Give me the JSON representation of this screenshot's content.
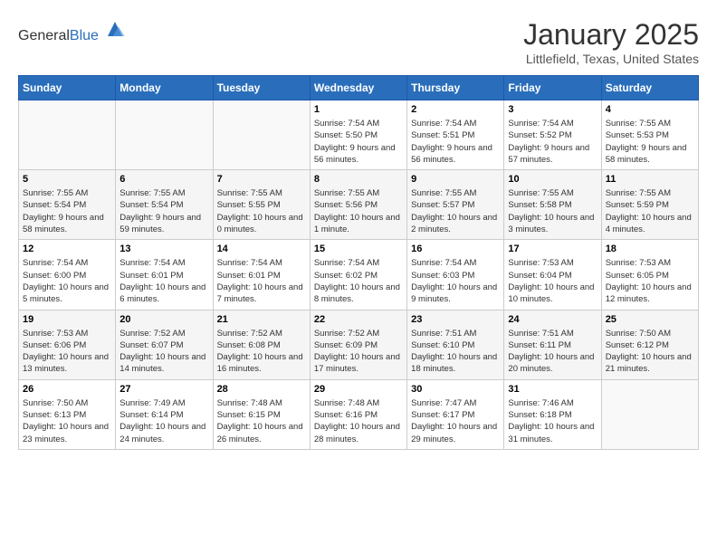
{
  "header": {
    "logo_general": "General",
    "logo_blue": "Blue",
    "month_title": "January 2025",
    "location": "Littlefield, Texas, United States"
  },
  "days_of_week": [
    "Sunday",
    "Monday",
    "Tuesday",
    "Wednesday",
    "Thursday",
    "Friday",
    "Saturday"
  ],
  "weeks": [
    [
      {
        "day": "",
        "sunrise": "",
        "sunset": "",
        "daylight": ""
      },
      {
        "day": "",
        "sunrise": "",
        "sunset": "",
        "daylight": ""
      },
      {
        "day": "",
        "sunrise": "",
        "sunset": "",
        "daylight": ""
      },
      {
        "day": "1",
        "sunrise": "Sunrise: 7:54 AM",
        "sunset": "Sunset: 5:50 PM",
        "daylight": "Daylight: 9 hours and 56 minutes."
      },
      {
        "day": "2",
        "sunrise": "Sunrise: 7:54 AM",
        "sunset": "Sunset: 5:51 PM",
        "daylight": "Daylight: 9 hours and 56 minutes."
      },
      {
        "day": "3",
        "sunrise": "Sunrise: 7:54 AM",
        "sunset": "Sunset: 5:52 PM",
        "daylight": "Daylight: 9 hours and 57 minutes."
      },
      {
        "day": "4",
        "sunrise": "Sunrise: 7:55 AM",
        "sunset": "Sunset: 5:53 PM",
        "daylight": "Daylight: 9 hours and 58 minutes."
      }
    ],
    [
      {
        "day": "5",
        "sunrise": "Sunrise: 7:55 AM",
        "sunset": "Sunset: 5:54 PM",
        "daylight": "Daylight: 9 hours and 58 minutes."
      },
      {
        "day": "6",
        "sunrise": "Sunrise: 7:55 AM",
        "sunset": "Sunset: 5:54 PM",
        "daylight": "Daylight: 9 hours and 59 minutes."
      },
      {
        "day": "7",
        "sunrise": "Sunrise: 7:55 AM",
        "sunset": "Sunset: 5:55 PM",
        "daylight": "Daylight: 10 hours and 0 minutes."
      },
      {
        "day": "8",
        "sunrise": "Sunrise: 7:55 AM",
        "sunset": "Sunset: 5:56 PM",
        "daylight": "Daylight: 10 hours and 1 minute."
      },
      {
        "day": "9",
        "sunrise": "Sunrise: 7:55 AM",
        "sunset": "Sunset: 5:57 PM",
        "daylight": "Daylight: 10 hours and 2 minutes."
      },
      {
        "day": "10",
        "sunrise": "Sunrise: 7:55 AM",
        "sunset": "Sunset: 5:58 PM",
        "daylight": "Daylight: 10 hours and 3 minutes."
      },
      {
        "day": "11",
        "sunrise": "Sunrise: 7:55 AM",
        "sunset": "Sunset: 5:59 PM",
        "daylight": "Daylight: 10 hours and 4 minutes."
      }
    ],
    [
      {
        "day": "12",
        "sunrise": "Sunrise: 7:54 AM",
        "sunset": "Sunset: 6:00 PM",
        "daylight": "Daylight: 10 hours and 5 minutes."
      },
      {
        "day": "13",
        "sunrise": "Sunrise: 7:54 AM",
        "sunset": "Sunset: 6:01 PM",
        "daylight": "Daylight: 10 hours and 6 minutes."
      },
      {
        "day": "14",
        "sunrise": "Sunrise: 7:54 AM",
        "sunset": "Sunset: 6:01 PM",
        "daylight": "Daylight: 10 hours and 7 minutes."
      },
      {
        "day": "15",
        "sunrise": "Sunrise: 7:54 AM",
        "sunset": "Sunset: 6:02 PM",
        "daylight": "Daylight: 10 hours and 8 minutes."
      },
      {
        "day": "16",
        "sunrise": "Sunrise: 7:54 AM",
        "sunset": "Sunset: 6:03 PM",
        "daylight": "Daylight: 10 hours and 9 minutes."
      },
      {
        "day": "17",
        "sunrise": "Sunrise: 7:53 AM",
        "sunset": "Sunset: 6:04 PM",
        "daylight": "Daylight: 10 hours and 10 minutes."
      },
      {
        "day": "18",
        "sunrise": "Sunrise: 7:53 AM",
        "sunset": "Sunset: 6:05 PM",
        "daylight": "Daylight: 10 hours and 12 minutes."
      }
    ],
    [
      {
        "day": "19",
        "sunrise": "Sunrise: 7:53 AM",
        "sunset": "Sunset: 6:06 PM",
        "daylight": "Daylight: 10 hours and 13 minutes."
      },
      {
        "day": "20",
        "sunrise": "Sunrise: 7:52 AM",
        "sunset": "Sunset: 6:07 PM",
        "daylight": "Daylight: 10 hours and 14 minutes."
      },
      {
        "day": "21",
        "sunrise": "Sunrise: 7:52 AM",
        "sunset": "Sunset: 6:08 PM",
        "daylight": "Daylight: 10 hours and 16 minutes."
      },
      {
        "day": "22",
        "sunrise": "Sunrise: 7:52 AM",
        "sunset": "Sunset: 6:09 PM",
        "daylight": "Daylight: 10 hours and 17 minutes."
      },
      {
        "day": "23",
        "sunrise": "Sunrise: 7:51 AM",
        "sunset": "Sunset: 6:10 PM",
        "daylight": "Daylight: 10 hours and 18 minutes."
      },
      {
        "day": "24",
        "sunrise": "Sunrise: 7:51 AM",
        "sunset": "Sunset: 6:11 PM",
        "daylight": "Daylight: 10 hours and 20 minutes."
      },
      {
        "day": "25",
        "sunrise": "Sunrise: 7:50 AM",
        "sunset": "Sunset: 6:12 PM",
        "daylight": "Daylight: 10 hours and 21 minutes."
      }
    ],
    [
      {
        "day": "26",
        "sunrise": "Sunrise: 7:50 AM",
        "sunset": "Sunset: 6:13 PM",
        "daylight": "Daylight: 10 hours and 23 minutes."
      },
      {
        "day": "27",
        "sunrise": "Sunrise: 7:49 AM",
        "sunset": "Sunset: 6:14 PM",
        "daylight": "Daylight: 10 hours and 24 minutes."
      },
      {
        "day": "28",
        "sunrise": "Sunrise: 7:48 AM",
        "sunset": "Sunset: 6:15 PM",
        "daylight": "Daylight: 10 hours and 26 minutes."
      },
      {
        "day": "29",
        "sunrise": "Sunrise: 7:48 AM",
        "sunset": "Sunset: 6:16 PM",
        "daylight": "Daylight: 10 hours and 28 minutes."
      },
      {
        "day": "30",
        "sunrise": "Sunrise: 7:47 AM",
        "sunset": "Sunset: 6:17 PM",
        "daylight": "Daylight: 10 hours and 29 minutes."
      },
      {
        "day": "31",
        "sunrise": "Sunrise: 7:46 AM",
        "sunset": "Sunset: 6:18 PM",
        "daylight": "Daylight: 10 hours and 31 minutes."
      },
      {
        "day": "",
        "sunrise": "",
        "sunset": "",
        "daylight": ""
      }
    ]
  ]
}
